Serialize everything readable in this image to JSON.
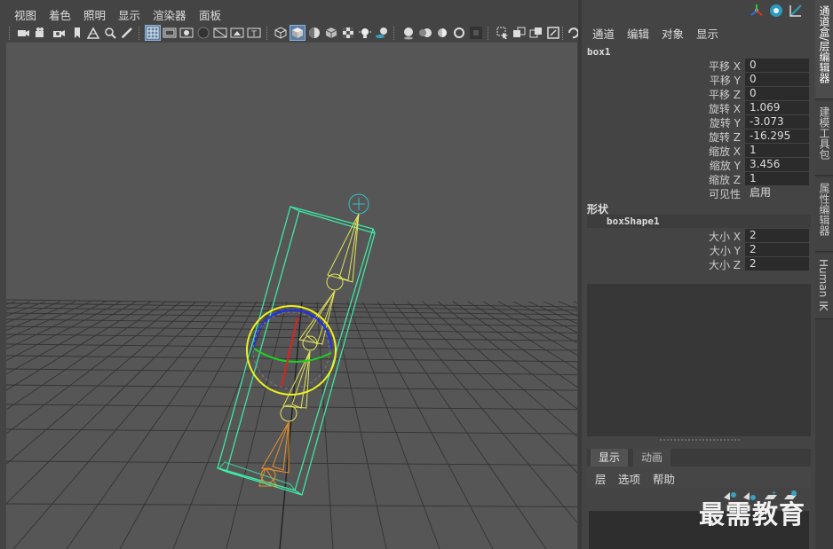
{
  "viewport": {
    "menu": [
      "视图",
      "着色",
      "照明",
      "显示",
      "渲染器",
      "面板"
    ]
  },
  "toolbar_icons": [
    "camera-icon",
    "camera-attribute-icon",
    "camera-bookmark-icon",
    "bookmark-icon",
    "image-plane-icon",
    "2d-pan-zoom-icon",
    "grease-pencil-icon",
    "grid-icon",
    "film-gate-icon",
    "resolution-gate-icon",
    "gate-mask-icon",
    "field-chart-icon",
    "safe-action-icon",
    "safe-title-icon",
    "wireframe-icon",
    "smooth-shade-icon",
    "default-material-icon",
    "bounding-box-icon",
    "textured-icon",
    "use-all-lights-icon",
    "shadows-icon",
    "screen-space-ao-icon",
    "motion-blur-icon",
    "multisample-aa-icon",
    "depth-of-field-icon",
    "isolate-select-icon",
    "xray-icon",
    "xray-joints-icon",
    "xray-active-icon",
    "backface-icon",
    "viewport2-icon"
  ],
  "channel_box": {
    "menu": [
      "通道",
      "编辑",
      "对象",
      "显示"
    ],
    "object_name": "box1",
    "attributes": [
      {
        "label": "平移 X",
        "value": "0"
      },
      {
        "label": "平移 Y",
        "value": "0"
      },
      {
        "label": "平移 Z",
        "value": "0"
      },
      {
        "label": "旋转 X",
        "value": "1.069"
      },
      {
        "label": "旋转 Y",
        "value": "-3.073"
      },
      {
        "label": "旋转 Z",
        "value": "-16.295"
      },
      {
        "label": "缩放 X",
        "value": "1"
      },
      {
        "label": "缩放 Y",
        "value": "3.456"
      },
      {
        "label": "缩放 Z",
        "value": "1"
      },
      {
        "label": "可见性",
        "value": "启用"
      }
    ],
    "shapes_header": "形状",
    "shape_name": "boxShape1",
    "shape_attributes": [
      {
        "label": "大小 X",
        "value": "2"
      },
      {
        "label": "大小 Y",
        "value": "2"
      },
      {
        "label": "大小 Z",
        "value": "2"
      }
    ]
  },
  "layer_editor": {
    "tabs": [
      "显示",
      "动画"
    ],
    "menu": [
      "层",
      "选项",
      "帮助"
    ]
  },
  "side_tabs": [
    "通道盒/层编辑器",
    "建模工具包",
    "属性编辑器",
    "Human IK"
  ],
  "watermark": "最需教育",
  "colors": {
    "viewport_bg": "#565656",
    "grid": "#333333",
    "box_wire": "#3df0a8",
    "joint_yellow": "#e3e35a",
    "joint_orange": "#e8902a",
    "joint_cyan": "#33c0c8",
    "manip_yellow": "#f0f020",
    "manip_blue": "#2232e8",
    "manip_red": "#e02020",
    "manip_green": "#20d020"
  }
}
